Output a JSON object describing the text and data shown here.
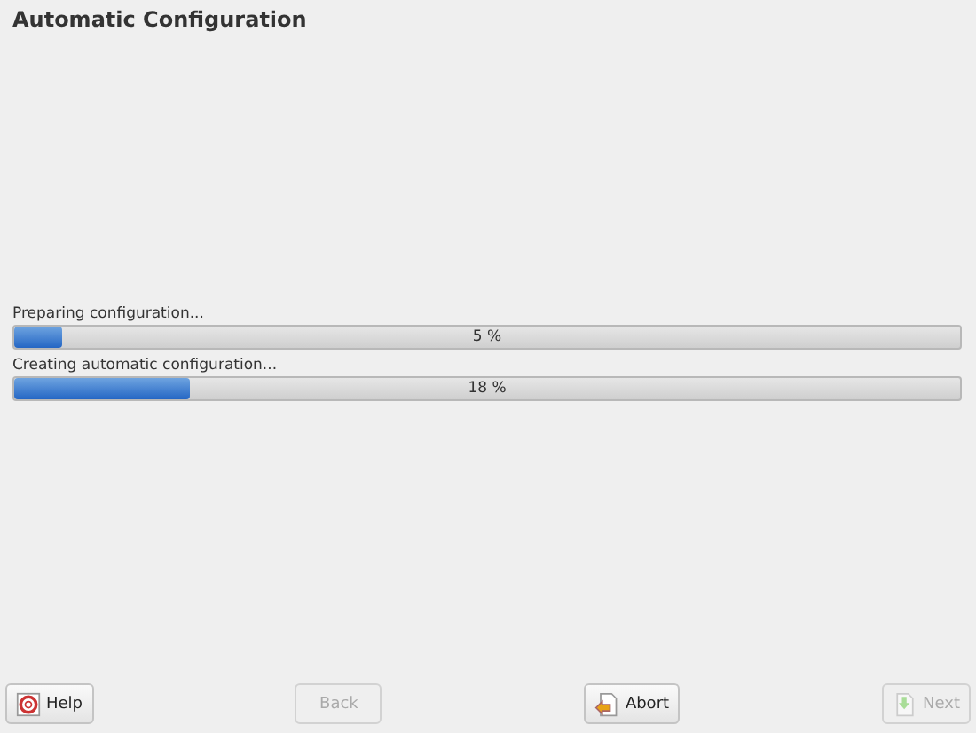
{
  "window": {
    "title": "Automatic Configuration"
  },
  "progress": [
    {
      "label": "Preparing configuration...",
      "level": 0.05,
      "reading": "5 %"
    },
    {
      "label": "Creating automatic configuration...",
      "level": 0.185,
      "reading": "18 %"
    }
  ],
  "buttons": [
    {
      "label": "Help",
      "kind": "help",
      "disabled": false
    },
    {
      "label": "Back",
      "kind": "back",
      "disabled": true
    },
    {
      "label": "Abort",
      "kind": "abort",
      "disabled": false
    },
    {
      "label": "Next",
      "kind": "next",
      "disabled": true
    }
  ]
}
